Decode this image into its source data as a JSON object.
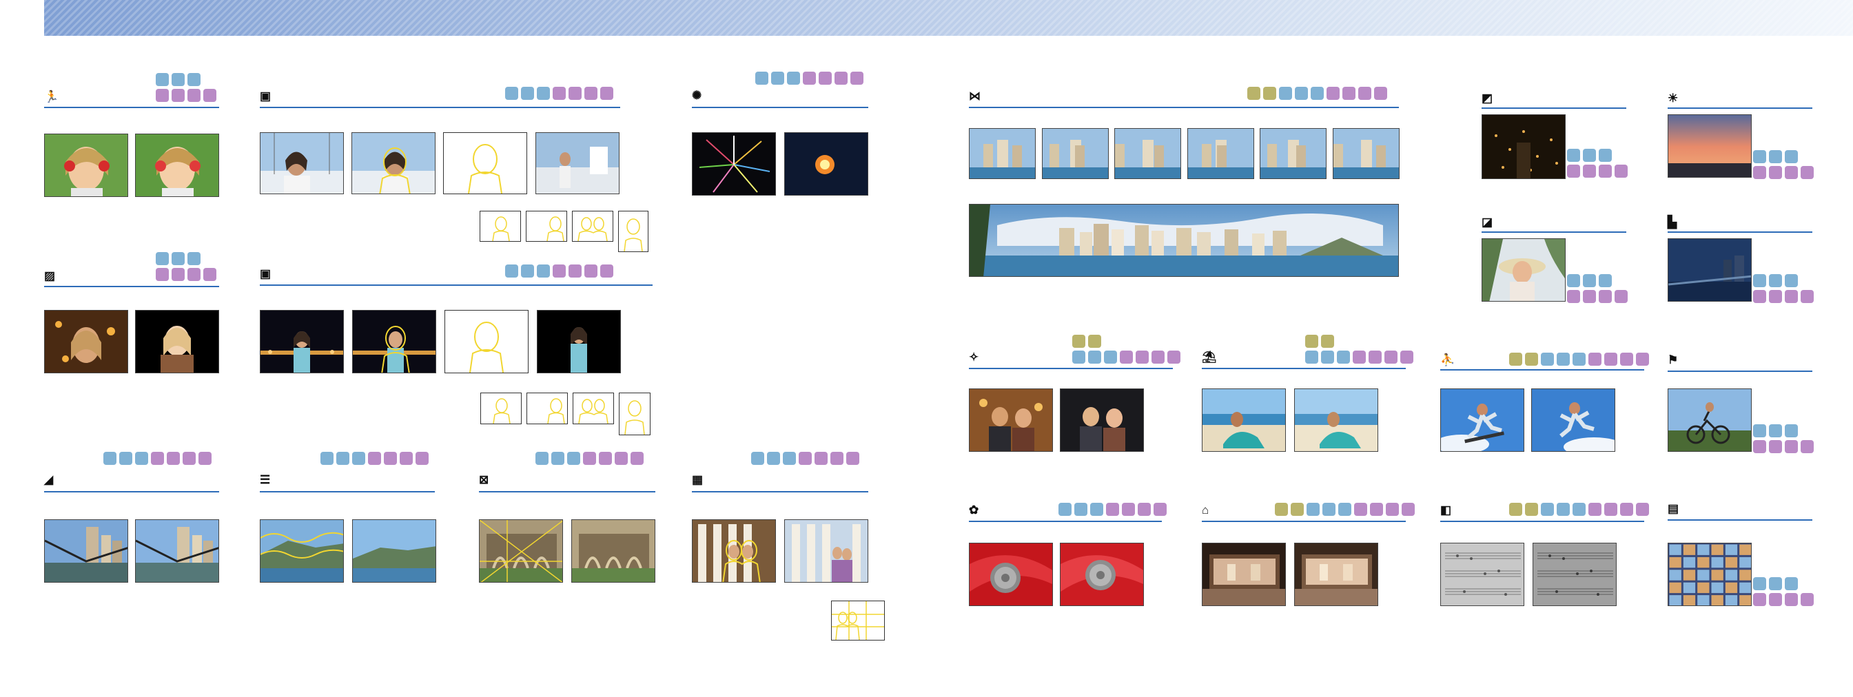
{
  "colors": {
    "banner_start": "#7f9fd4",
    "rule": "#2d6cb8",
    "dot_blue": "#7fb1d4",
    "dot_purple": "#b98ac6",
    "dot_olive": "#b9b36a",
    "outline": "#f2d630"
  },
  "sections": [
    {
      "id": "s1",
      "icon": "portrait-mode-icon",
      "glyph": "🏃",
      "dots": [
        [
          "b",
          "b",
          "b"
        ],
        [
          "p",
          "p",
          "p",
          "p"
        ]
      ]
    },
    {
      "id": "s2",
      "icon": "face-framing-icon",
      "glyph": "▣",
      "dots": [
        [
          "b",
          "b",
          "b",
          "p",
          "p",
          "p",
          "p"
        ]
      ]
    },
    {
      "id": "s3",
      "icon": "fireworks-icon",
      "glyph": "✺",
      "dots": [
        [
          "b",
          "b",
          "b",
          "p",
          "p",
          "p",
          "p"
        ]
      ]
    },
    {
      "id": "s4",
      "icon": "night-portrait-icon",
      "glyph": "▨",
      "dots": [
        [
          "b",
          "b",
          "b"
        ],
        [
          "p",
          "p",
          "p",
          "p"
        ]
      ]
    },
    {
      "id": "s5",
      "icon": "night-face-framing-icon",
      "glyph": "▣",
      "dots": [
        [
          "b",
          "b",
          "b",
          "p",
          "p",
          "p",
          "p"
        ]
      ]
    },
    {
      "id": "s6",
      "icon": "landscape-icon",
      "glyph": "◢",
      "dots": [
        [
          "b",
          "b",
          "b",
          "p",
          "p",
          "p",
          "p"
        ]
      ]
    },
    {
      "id": "s7",
      "icon": "horizon-icon",
      "glyph": "☰",
      "dots": [
        [
          "b",
          "b",
          "b",
          "p",
          "p",
          "p",
          "p"
        ]
      ]
    },
    {
      "id": "s8",
      "icon": "composition-icon",
      "glyph": "⊠",
      "dots": [
        [
          "b",
          "b",
          "b",
          "p",
          "p",
          "p",
          "p"
        ]
      ]
    },
    {
      "id": "s9",
      "icon": "group-icon",
      "glyph": "▦",
      "dots": [
        [
          "b",
          "b",
          "b",
          "p",
          "p",
          "p",
          "p"
        ]
      ]
    },
    {
      "id": "s10",
      "icon": "panorama-icon",
      "glyph": "⋈",
      "dots": [
        [
          "o",
          "o",
          "b",
          "b",
          "b",
          "p",
          "p",
          "p",
          "p"
        ]
      ]
    },
    {
      "id": "s11",
      "icon": "night-landscape-icon",
      "glyph": "◩",
      "dots": [
        [
          "b",
          "b",
          "b"
        ],
        [
          "p",
          "p",
          "p",
          "p"
        ]
      ]
    },
    {
      "id": "s12",
      "icon": "sunset-icon",
      "glyph": "☀",
      "dots": [
        [
          "b",
          "b",
          "b"
        ],
        [
          "p",
          "p",
          "p",
          "p"
        ]
      ]
    },
    {
      "id": "s13",
      "icon": "backlight-icon",
      "glyph": "◪",
      "dots": [
        [
          "b",
          "b",
          "b"
        ],
        [
          "p",
          "p",
          "p",
          "p"
        ]
      ]
    },
    {
      "id": "s14",
      "icon": "night-cityscape-icon",
      "glyph": "▙",
      "dots": [
        [
          "b",
          "b",
          "b"
        ],
        [
          "p",
          "p",
          "p",
          "p"
        ]
      ]
    },
    {
      "id": "s15",
      "icon": "party-icon",
      "glyph": "✧",
      "dots": [
        [
          "o",
          "o"
        ],
        [
          "b",
          "b",
          "b",
          "p",
          "p",
          "p",
          "p"
        ]
      ]
    },
    {
      "id": "s16",
      "icon": "beach-icon",
      "glyph": "⛱",
      "dots": [
        [
          "o",
          "o"
        ],
        [
          "b",
          "b",
          "b",
          "p",
          "p",
          "p",
          "p"
        ]
      ]
    },
    {
      "id": "s17",
      "icon": "sports-icon",
      "glyph": "⛹",
      "dots": [
        [
          "o",
          "o",
          "b",
          "b",
          "b",
          "p",
          "p",
          "p",
          "p"
        ]
      ]
    },
    {
      "id": "s18",
      "icon": "pet-icon",
      "glyph": "⚑",
      "dots": [
        [
          "b",
          "b",
          "b"
        ],
        [
          "p",
          "p",
          "p",
          "p"
        ]
      ]
    },
    {
      "id": "s19",
      "icon": "close-up-icon",
      "glyph": "✿",
      "dots": [
        [
          "b",
          "b",
          "b",
          "p",
          "p",
          "p",
          "p"
        ]
      ]
    },
    {
      "id": "s20",
      "icon": "museum-icon",
      "glyph": "⌂",
      "dots": [
        [
          "o",
          "o",
          "b",
          "b",
          "b",
          "p",
          "p",
          "p",
          "p"
        ]
      ]
    },
    {
      "id": "s21",
      "icon": "text-icon",
      "glyph": "◧",
      "dots": [
        [
          "o",
          "o",
          "b",
          "b",
          "b",
          "p",
          "p",
          "p",
          "p"
        ]
      ]
    },
    {
      "id": "s22",
      "icon": "multi-shot-icon",
      "glyph": "▤",
      "dots": [
        [
          "b",
          "b",
          "b"
        ],
        [
          "p",
          "p",
          "p",
          "p"
        ]
      ]
    }
  ]
}
